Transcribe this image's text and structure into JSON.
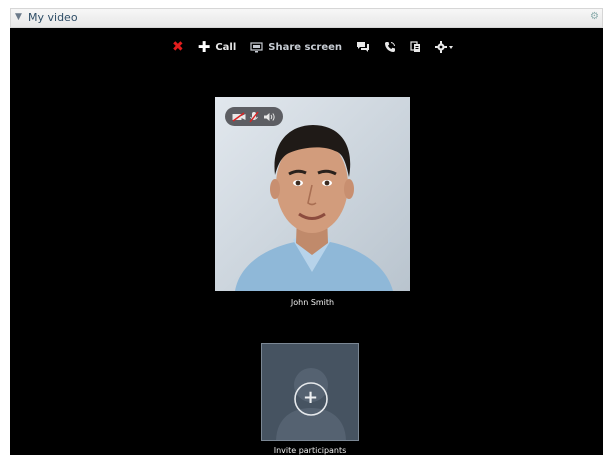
{
  "panel": {
    "title": "My video"
  },
  "toolbar": {
    "call_label": "Call",
    "share_label": "Share screen"
  },
  "participant": {
    "name": "John Smith"
  },
  "invite": {
    "label": "Invite participants"
  },
  "icons": {
    "collapse": "caret-down-icon",
    "panel_settings": "gear-icon",
    "end": "close-icon",
    "add": "plus-icon",
    "share": "monitor-icon",
    "chat": "chat-bubbles-icon",
    "phone": "phone-icon",
    "copy": "copy-icon",
    "settings": "gear-dropdown-icon",
    "video_off": "video-off-icon",
    "mic_off": "mic-off-icon",
    "volume": "speaker-icon"
  },
  "colors": {
    "stage_bg": "#000000",
    "close_red": "#e31d1d",
    "header_text": "#2e4d66"
  }
}
